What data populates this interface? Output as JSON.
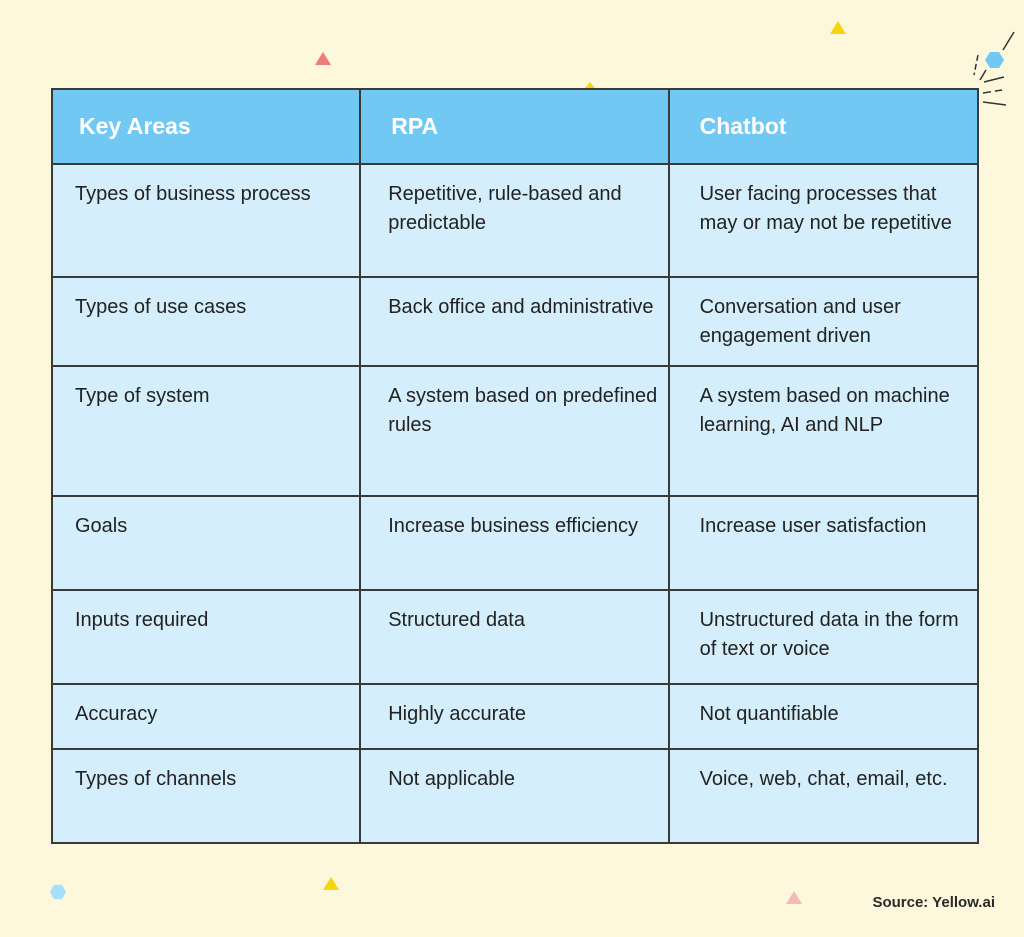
{
  "table": {
    "headers": [
      "Key Areas",
      "RPA",
      "Chatbot"
    ],
    "rows": [
      [
        "Types of business process",
        "Repetitive, rule-based and predictable",
        "User facing processes that may or may not be repetitive"
      ],
      [
        "Types of use cases",
        "Back office and administrative",
        "Conversation and user engagement driven"
      ],
      [
        "Type of system",
        "A system based on predefined rules",
        "A system based on machine learning, AI and NLP"
      ],
      [
        "Goals",
        "Increase business efficiency",
        "Increase user satisfaction"
      ],
      [
        "Inputs required",
        "Structured data",
        "Unstructured data in the form of text or voice"
      ],
      [
        "Accuracy",
        "Highly accurate",
        "Not quantifiable"
      ],
      [
        "Types of channels",
        "Not applicable",
        "Voice, web, chat, email, etc."
      ]
    ]
  },
  "source": "Source: Yellow.ai",
  "colors": {
    "background": "#fdf8dc",
    "header_fill": "#71c9f3",
    "cell_fill": "#d5eefb",
    "border": "#3a3a3a",
    "accent_yellow": "#f8d40a",
    "accent_red": "#f07b7b"
  },
  "decorations": [
    "triangle-red",
    "triangle-yellow",
    "hexagon-blue",
    "burst-lines",
    "triangle-pink"
  ]
}
